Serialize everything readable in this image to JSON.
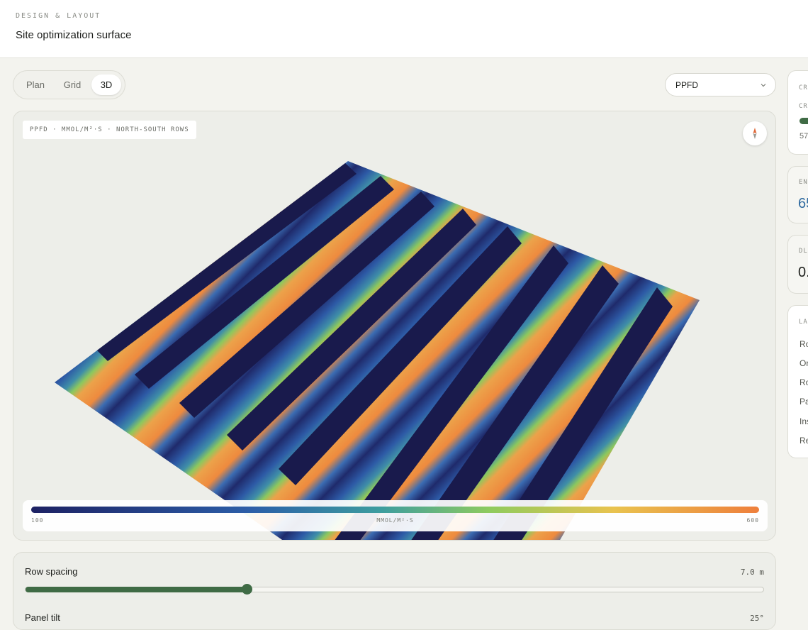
{
  "header": {
    "eyebrow": "DESIGN & LAYOUT",
    "title": "Site optimization surface"
  },
  "view_toggle": {
    "options": [
      "Plan",
      "Grid",
      "3D"
    ],
    "selected": "3D"
  },
  "metric_select": {
    "value": "PPFD"
  },
  "viewport": {
    "label": "PPFD · MMOL/M²·S · NORTH-SOUTH ROWS",
    "compass_icon": "compass-icon",
    "legend": {
      "min": "100",
      "max": "600",
      "unit": "MMOL/M²·S"
    }
  },
  "controls": {
    "row_spacing": {
      "label": "Row spacing",
      "value": "7.0 m",
      "fraction": 0.3
    },
    "panel_tilt": {
      "label": "Panel tilt",
      "value": "25°"
    }
  },
  "side_panel": {
    "crop_card": {
      "eyebrow": "CR",
      "sub_eyebrow": "CR",
      "value": "57"
    },
    "energy_card": {
      "eyebrow": "EN",
      "value": "65"
    },
    "dli_card": {
      "eyebrow": "DL",
      "value": "0."
    },
    "layout_card": {
      "eyebrow": "LA",
      "rows": [
        "Ro",
        "Or",
        "Ro",
        "Pa",
        "Ins",
        "Re"
      ]
    }
  },
  "colors": {
    "accent": "#3f6b45",
    "energy_value": "#2f6aa0",
    "panel": "#1b1a4a"
  }
}
